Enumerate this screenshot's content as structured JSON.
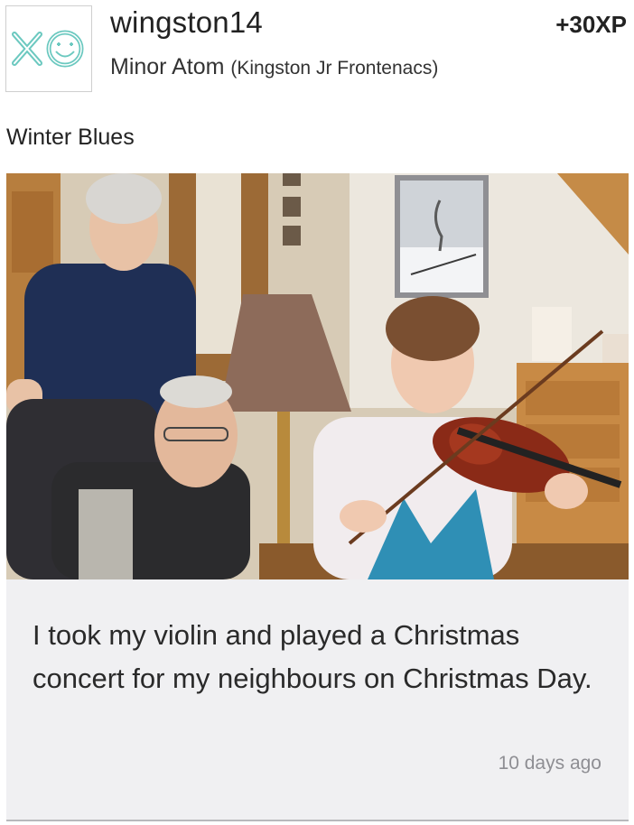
{
  "user": {
    "username": "wingston14",
    "rank": "Minor Atom",
    "team": "(Kingston Jr Frontenacs)",
    "xp": "+30XP",
    "avatar_icon": "xo-smiley-avatar-icon"
  },
  "post": {
    "title": "Winter Blues",
    "photo_icon": "photo-family-violin",
    "caption": "I took my violin and played a Christmas concert for my neighbours on Christmas Day.",
    "timestamp": "10 days ago"
  },
  "colors": {
    "avatar_accent": "#6cc9c0",
    "caption_bg": "#f0f0f2",
    "timestamp": "#8e8e93"
  }
}
